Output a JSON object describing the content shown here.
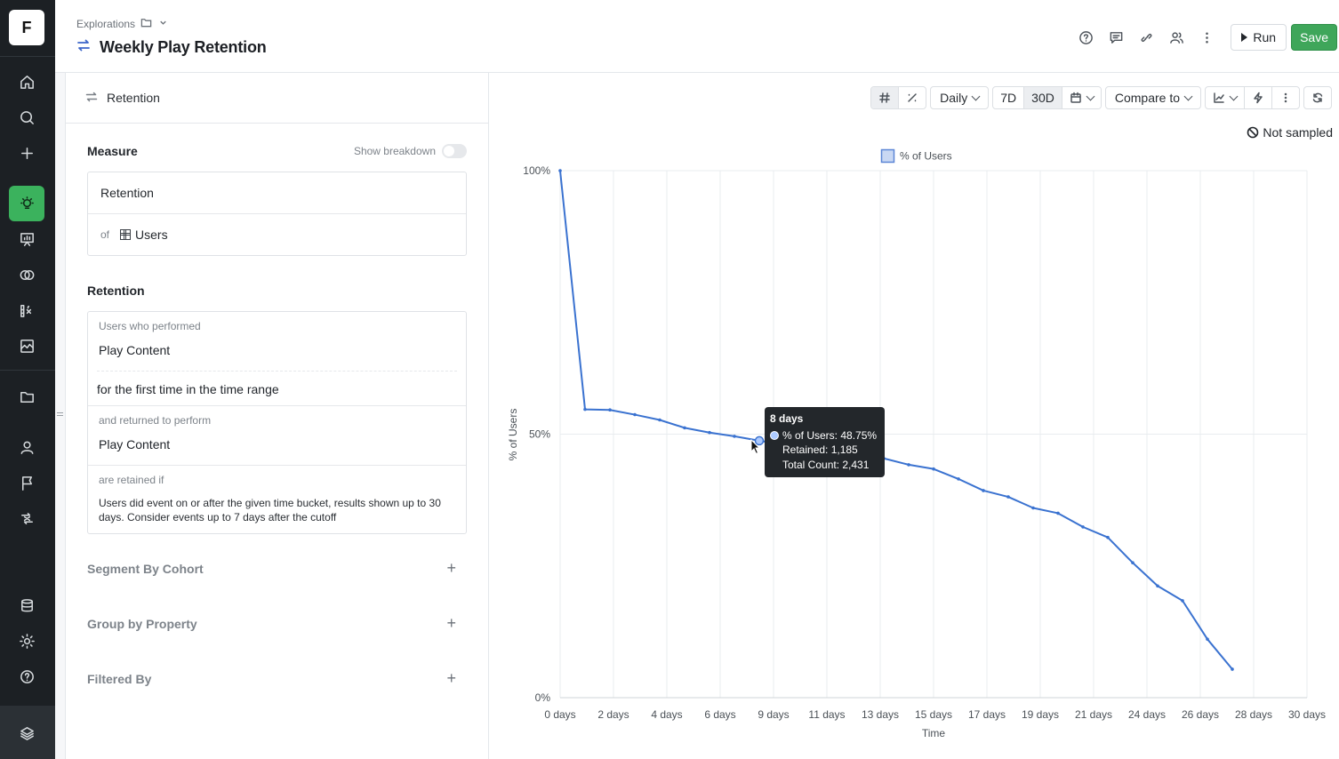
{
  "app": {
    "logo_letter": "F"
  },
  "rail": {
    "items": [
      {
        "name": "home-icon",
        "active": false
      },
      {
        "name": "search-icon",
        "active": false
      },
      {
        "name": "plus-icon",
        "active": false
      },
      {
        "name": "explorations-bulb-icon",
        "active": true
      },
      {
        "name": "presentation-icon",
        "active": false
      },
      {
        "name": "overlap-circles-icon",
        "active": false
      },
      {
        "name": "metrics-fx-icon",
        "active": false
      },
      {
        "name": "chart-image-icon",
        "active": false
      },
      {
        "name": "folder-icon",
        "active": false
      },
      {
        "name": "user-icon",
        "active": false
      },
      {
        "name": "flag-icon",
        "active": false
      },
      {
        "name": "experiment-icon",
        "active": false
      },
      {
        "name": "database-icon",
        "active": false
      },
      {
        "name": "settings-gear-icon",
        "active": false
      },
      {
        "name": "help-icon",
        "active": false
      },
      {
        "name": "brand-stack-icon",
        "active": false
      }
    ]
  },
  "header": {
    "breadcrumb": "Explorations",
    "title": "Weekly Play Retention",
    "run_label": "Run",
    "save_label": "Save"
  },
  "left_panel": {
    "head_label": "Retention",
    "measure": {
      "label": "Measure",
      "show_breakdown": "Show breakdown",
      "metric": "Retention",
      "of_label": "of",
      "entity": "Users"
    },
    "retention": {
      "label": "Retention",
      "performed_label": "Users who performed",
      "first_event": "Play Content",
      "first_time_text": "for the first time in the time range",
      "returned_label": "and returned to perform",
      "return_event": "Play Content",
      "retained_if_label": "are retained if",
      "retained_if_text": "Users did event on or after the given time bucket, results shown up to 30 days. Consider events up to 7 days after the cutoff"
    },
    "segment_by_cohort": "Segment By Cohort",
    "group_by_property": "Group by Property",
    "filtered_by": "Filtered By"
  },
  "toolbar": {
    "granularity": "Daily",
    "range_7d": "7D",
    "range_30d": "30D",
    "compare_to": "Compare to",
    "not_sampled": "Not sampled"
  },
  "tooltip": {
    "title": "8 days",
    "series_line": "% of Users: 48.75%",
    "retained_line": "Retained: 1,185",
    "total_line": "Total Count: 2,431"
  },
  "chart_data": {
    "type": "line",
    "title": "",
    "xlabel": "Time",
    "ylabel": "% of Users",
    "legend": [
      "% of Users"
    ],
    "legend_position": "top-center",
    "grid": true,
    "ylim": [
      0,
      100
    ],
    "y_ticks": [
      "0%",
      "50%",
      "100%"
    ],
    "x_tick_labels": [
      "0 days",
      "2 days",
      "4 days",
      "6 days",
      "9 days",
      "11 days",
      "13 days",
      "15 days",
      "17 days",
      "19 days",
      "21 days",
      "24 days",
      "26 days",
      "28 days",
      "30 days"
    ],
    "series": [
      {
        "name": "% of Users",
        "color": "#3a72d0",
        "x": [
          0,
          1,
          2,
          3,
          4,
          5,
          6,
          7,
          8,
          9,
          10,
          11,
          12,
          13,
          14,
          15,
          16,
          17,
          18,
          19,
          20,
          21,
          22,
          23,
          24,
          25,
          26,
          27,
          28
        ],
        "y": [
          100,
          54.7,
          54.6,
          53.7,
          52.7,
          51.2,
          50.3,
          49.6,
          48.75,
          48.0,
          47.4,
          46.1,
          45.6,
          45.4,
          44.2,
          43.4,
          41.5,
          39.3,
          38.1,
          36.0,
          35.0,
          32.4,
          30.4,
          25.6,
          21.2,
          18.4,
          11.1,
          5.4,
          null
        ]
      }
    ]
  }
}
